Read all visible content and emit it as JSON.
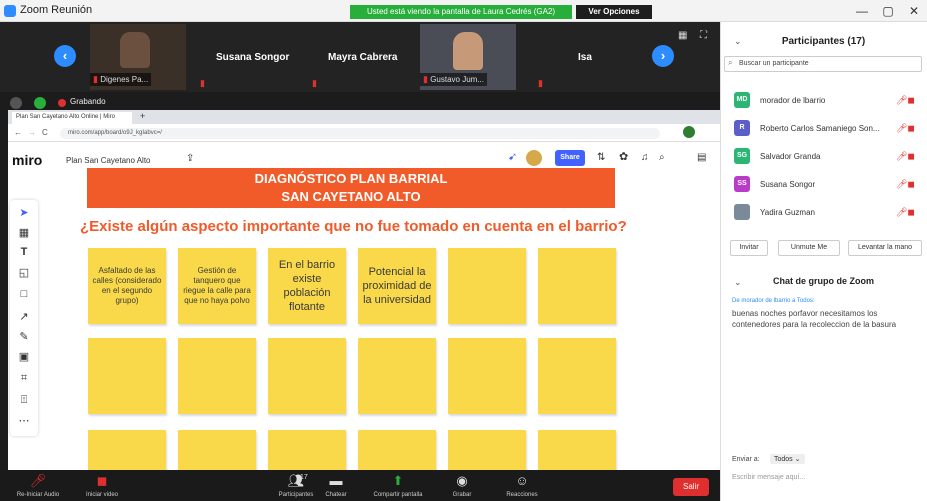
{
  "window": {
    "title": "Zoom Reunión",
    "share_banner": "Usted está viendo la pantalla de Laura Cedrés (GA2)",
    "view_options": "Ver Opciones",
    "minimize": "—",
    "maximize": "▢",
    "close": "✕"
  },
  "thumbnails": [
    {
      "name": "Digenes Pa..."
    },
    {
      "name": "Susana Songor"
    },
    {
      "name": "Mayra Cabrera"
    },
    {
      "name": "Gustavo Jum..."
    },
    {
      "name": "Isa"
    }
  ],
  "recording": {
    "label": "Grabando"
  },
  "browser": {
    "tab_title": "Plan San Cayetano Alto Online | Miro",
    "url": "miro.com/app/board/o9J_kgIabvc=/"
  },
  "miro": {
    "logo": "miro",
    "board_name": "Plan San Cayetano Alto",
    "share_label": "Share"
  },
  "board": {
    "header_line1": "DIAGNÓSTICO PLAN BARRIAL",
    "header_line2": "SAN CAYETANO ALTO",
    "question": "¿Existe algún aspecto importante que no fue tomado en cuenta en el barrio?",
    "stickies": [
      "Asfaltado de las calles (considerado en el segundo grupo)",
      "Gestión de tanquero que riegue la calle para que no haya polvo",
      "En el barrio existe población flotante",
      "Potencial la proximidad de la universidad",
      "",
      ""
    ]
  },
  "bottom_bar": {
    "audio": "Re-Iniciar Audio",
    "video": "Iniciar video",
    "participants_count": "17",
    "participants": "Participantes",
    "chat": "Chatear",
    "share": "Compartir pantalla",
    "record": "Grabar",
    "reactions": "Reacciones",
    "leave": "Salir"
  },
  "panel": {
    "participants_title": "Participantes (17)",
    "search_placeholder": "Buscar un participante",
    "participants": [
      {
        "initials": "MD",
        "name": "morador de lbarrio",
        "color": "#2bb673"
      },
      {
        "initials": "R",
        "name": "Roberto Carlos Samaniego Son...",
        "color": "#5b5fc7"
      },
      {
        "initials": "SG",
        "name": "Salvador Granda",
        "color": "#2bb673"
      },
      {
        "initials": "SS",
        "name": "Susana Songor",
        "color": "#b83cc6"
      },
      {
        "initials": "",
        "name": "Yadira Guzman",
        "color": "#7a8a99"
      }
    ],
    "invite": "Invitar",
    "unmute": "Unmute Me",
    "raise_hand": "Levantar la mano",
    "chat_title": "Chat de grupo de Zoom",
    "chat_from": "De morador de lbarrio a Todos:",
    "chat_message": "buenas noches porfavor necesitamos los contenedores para la recoleccion de la basura",
    "send_to_label": "Enviar a:",
    "send_to_value": "Todos",
    "chat_placeholder": "Escribir mensaje aquí..."
  }
}
